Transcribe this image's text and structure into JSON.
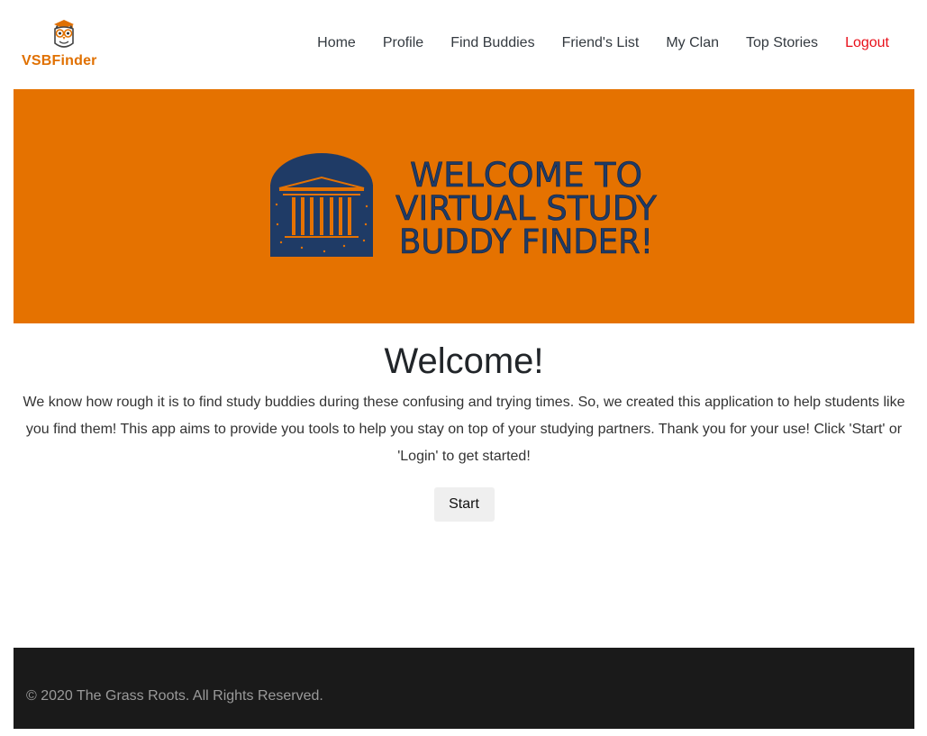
{
  "brand": {
    "name": "VSBFinder",
    "logo_icon": "owl-icon",
    "accent_color": "#e07000"
  },
  "nav": {
    "items": [
      {
        "label": "Home"
      },
      {
        "label": "Profile"
      },
      {
        "label": "Find Buddies"
      },
      {
        "label": "Friend's List"
      },
      {
        "label": "My Clan"
      },
      {
        "label": "Top Stories"
      }
    ],
    "logout_label": "Logout",
    "logout_color": "#e8101a"
  },
  "hero": {
    "background_color": "#e57200",
    "logo_icon": "rotunda-icon",
    "banner_line1": "WELCOME TO",
    "banner_line2": "VIRTUAL STUDY",
    "banner_line3": "BUDDY FINDER!",
    "banner_color": "#1f3b66"
  },
  "main": {
    "title": "Welcome!",
    "intro": "We know how rough it is to find study buddies during these confusing and trying times. So, we created this application to help students like you find them! This app aims to provide you tools to help you stay on top of your studying partners. Thank you for your use! Click 'Start' or 'Login' to get started!",
    "start_label": "Start"
  },
  "footer": {
    "text": "© 2020 The Grass Roots. All Rights Reserved."
  }
}
